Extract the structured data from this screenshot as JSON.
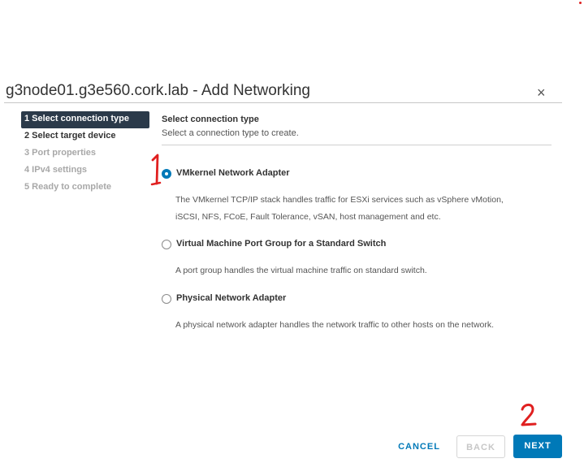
{
  "dialog": {
    "title": "g3node01.g3e560.cork.lab - Add Networking",
    "close_glyph": "×"
  },
  "steps": [
    {
      "label": "1 Select connection type",
      "state": "active"
    },
    {
      "label": "2 Select target device",
      "state": "enabled"
    },
    {
      "label": "3 Port properties",
      "state": "disabled"
    },
    {
      "label": "4 IPv4 settings",
      "state": "disabled"
    },
    {
      "label": "5 Ready to complete",
      "state": "disabled"
    }
  ],
  "content": {
    "heading": "Select connection type",
    "subheading": "Select a connection type to create.",
    "options": [
      {
        "label": "VMkernel Network Adapter",
        "checked": true,
        "description_line1": "The VMkernel TCP/IP stack handles traffic for ESXi services such as vSphere vMotion,",
        "description_line2": "iSCSI, NFS, FCoE, Fault Tolerance, vSAN, host management and etc."
      },
      {
        "label": "Virtual Machine Port Group for a Standard Switch",
        "checked": false,
        "description": "A port group handles the virtual machine traffic on standard switch."
      },
      {
        "label": "Physical Network Adapter",
        "checked": false,
        "description": "A physical network adapter handles the network traffic to other hosts on the network."
      }
    ]
  },
  "footer": {
    "cancel_label": "CANCEL",
    "back_label": "BACK",
    "next_label": "NEXT"
  },
  "colors": {
    "accent": "#0079b8",
    "active_step_bg": "#2b3a4a",
    "annotation": "#e02020"
  }
}
